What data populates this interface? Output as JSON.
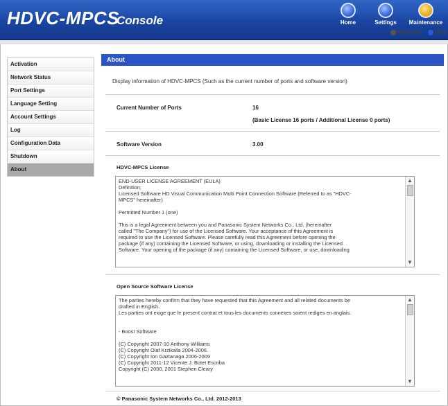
{
  "header": {
    "brand": "HDVC-MPCS",
    "title": "Console",
    "buttons": [
      {
        "label": "Home",
        "icon": "home-icon"
      },
      {
        "label": "Settings",
        "icon": "settings-icon"
      },
      {
        "label": "Maintenance",
        "icon": "maintenance-icon"
      }
    ],
    "links": {
      "message": "Message",
      "help": "Help"
    }
  },
  "sidebar": {
    "items": [
      {
        "label": "Activation"
      },
      {
        "label": "Network Status"
      },
      {
        "label": "Port Settings"
      },
      {
        "label": "Language Setting"
      },
      {
        "label": "Account Settings"
      },
      {
        "label": "Log"
      },
      {
        "label": "Configuration Data"
      },
      {
        "label": "Shutdown"
      },
      {
        "label": "About",
        "active": true
      }
    ]
  },
  "main": {
    "section_title": "About",
    "description": "Display information of HDVC-MPCS (Such as the current number of ports and software version)",
    "current_ports_label": "Current Number of Ports",
    "current_ports_value": "16",
    "current_ports_detail": "(Basic License 16 ports / Additional License 0 ports)",
    "software_version_label": "Software Version",
    "software_version_value": "3.00",
    "license_heading": "HDVC-MPCS License",
    "license_text": [
      "END-USER LICENSE AGREEMENT (EULA)",
      "Definition:",
      "Licensed Software   HD Visual Communication Multi Point Connection Software (Referred to as \"HDVC-",
      "MPCS\" hereinafter)",
      "",
      "Permitted Number   1 (one)",
      "",
      "This is a legal Agreement between you and Panasonic System Networks Co., Ltd. (hereinafter",
      "called \"The Company\") for use of the Licensed Software.  Your acceptance of this Agreement is",
      "required to use the Licensed Software.  Please carefully read this Agreement before opening the",
      "package (if any) containing the Licensed Software, or using, downloading or installing the Licensed",
      "Software.  Your opening of the package (if any) containing the Licensed Software, or use, downloading"
    ],
    "oss_heading": "Open Source Software License",
    "oss_text": [
      "The parties hereby confirm that they have requested that this Agreement and all related documents be",
      "drafted in English.",
      "Les parties ont exige que le present contrat et tous les documents connexes soient rediges en anglais.",
      "",
      "",
      "- Boost Software",
      "",
      "(C) Copyright 2007-10 Anthony Williams",
      "(C) Copyright Olaf Krzikalla 2004-2006.",
      "(C) Copyright Ion Gaztanaga  2006-2009",
      "(C) Copyright 2011-12 Vicente J. Botet Escriba",
      "Copyright (C) 2000, 2001 Stephen Cleary"
    ],
    "copyright": "© Panasonic System Networks Co., Ltd. 2012-2013"
  }
}
